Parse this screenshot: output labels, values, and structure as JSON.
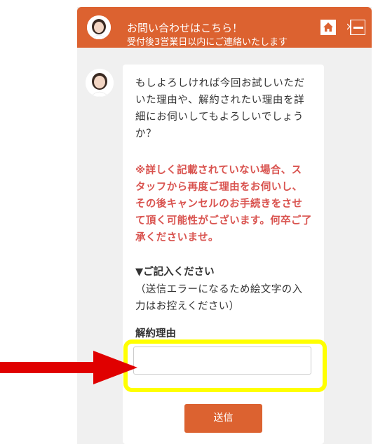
{
  "header": {
    "title": "お問い合わせはこちら！",
    "subtitle": "受付後3営業日以内にご連絡いたします",
    "home_icon": "home-icon",
    "close_icon": "close-icon",
    "background_color": "#dc6230"
  },
  "message": {
    "intro": "もしよろしければ今回お試しいただいた理由や、解約されたい理由を詳細にお伺いしてもよろしいでしょうか？",
    "warning": "※詳しく記載されていない場合、スタッフから再度ご理由をお伺いし、その後キャンセルのお手続きをさせて頂く可能性がございます。何卒ご了承くださいませ。",
    "heading": "▼ご記入ください",
    "note": "（送信エラーになるため絵文字の入力はお控えください）",
    "warning_color": "#d9534f"
  },
  "form": {
    "field_label": "解約理由",
    "input_value": "",
    "submit_label": "送信"
  },
  "annotation": {
    "highlight_color": "#ffff00",
    "arrow_color": "#e00000"
  }
}
